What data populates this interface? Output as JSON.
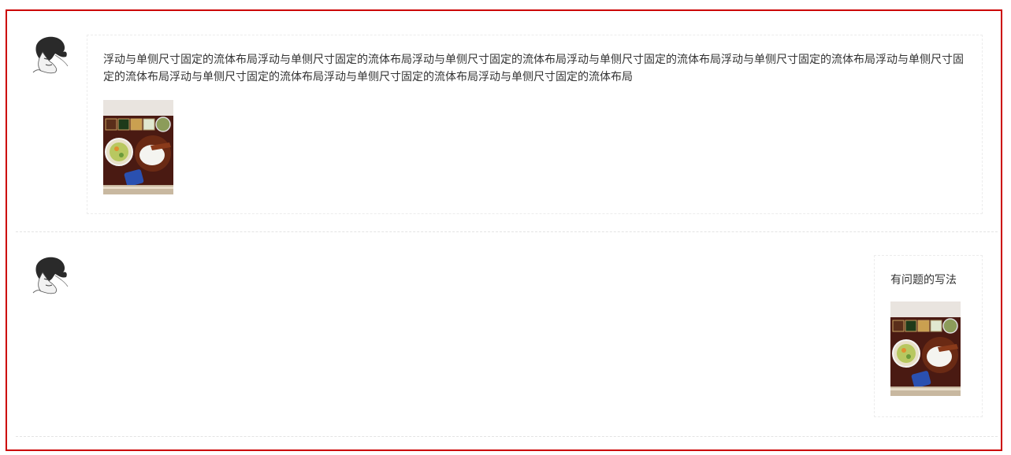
{
  "posts": [
    {
      "text": "浮动与单侧尺寸固定的流体布局浮动与单侧尺寸固定的流体布局浮动与单侧尺寸固定的流体布局浮动与单侧尺寸固定的流体布局浮动与单侧尺寸固定的流体布局浮动与单侧尺寸固定的流体布局浮动与单侧尺寸固定的流体布局浮动与单侧尺寸固定的流体布局浮动与单侧尺寸固定的流体布局"
    },
    {
      "text": "有问题的写法"
    }
  ],
  "colors": {
    "frame_border": "#cc0000",
    "divider": "#e3e3e3",
    "box_border": "#ececec"
  }
}
